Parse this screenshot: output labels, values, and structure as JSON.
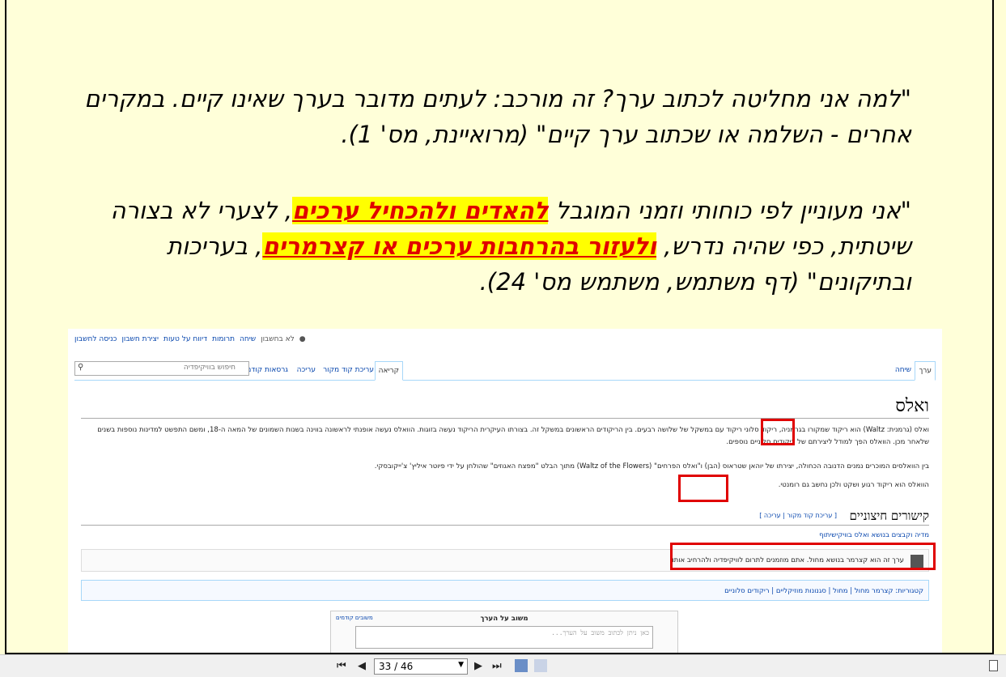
{
  "slide": {
    "quote1": "\"למה אני מחליטה לכתוב ערך? זה מורכב: לעתים מדובר בערך שאינו קיים. במקרים אחרים - השלמה או שכתוב ערך קיים\" (מרואיינת, מס' 1).",
    "quote2_part1": "\"אני מעוניין לפי כוחותי וזמני המוגבל ",
    "quote2_hl1": "להאדים ולהכחיל ערכים",
    "quote2_part2": ", לצערי לא בצורה שיטתית, כפי שהיה נדרש, ",
    "quote2_hl2": "ולעזור בהרחבות ערכים או קצרמרים",
    "quote2_part3": ", בעריכות ובתיקונים\" (דף משתמש, משתמש מס' 24)."
  },
  "wiki": {
    "personal": [
      "לא בחשבון",
      "שיחה",
      "תרומות",
      "דיווח על טעות",
      "יצירת חשבון",
      "כניסה לחשבון"
    ],
    "tabs_right": [
      "ערך",
      "שיחה"
    ],
    "tabs_left": [
      "קריאה",
      "עריכת קוד מקור",
      "עריכה",
      "גרסאות קודמות"
    ],
    "search_placeholder": "חיפוש בוויקיפדיה",
    "title": "ואלס",
    "para1": "ואלס (גרמנית: Waltz) הוא ריקוד שמקורו בגרמניה, ריקוד סלוני ריקוד עם במשקל של שלושה רבעים. בין הריקודים הראשונים במשקל זה. בצורתו העיקרית הריקוד נעשה בזוגות. הוואלס נעשה אופנתי לראשונה בווינה בשנות השמונים של המאה ה-18, ומשם התפשט למדינות נוספות בשנים שלאחר מכן. הוואלס הפך למודל ליצירתם של ריקודים סלוניים נוספים.",
    "para2": "בין הוואלסים המוכרים נמנים הדנובה הכחולה, יצירתו של יוהאן שטראוס (הבן) ו\"ואלס הפרחים\" (Waltz of the Flowers) מתוך הבלט \"מפצח האגוזים\" שהולחן על ידי פיוטר איליץ' צ'ייקובסקי.",
    "para3": "הוואלס הוא ריקוד רגוע ושקט ולכן נחשב גם רומנטי.",
    "section": "קישורים חיצוניים",
    "section_edit": "[ עריכת קוד מקור | עריכה ]",
    "commons": "מדיה וקבצים בנושא ואלס בוויקישיתוף",
    "stub": "ערך זה הוא קצרמר בנושא מחול. אתם מוזמנים לתרום לוויקיפדיה ולהרחיב אותו.",
    "categories": "קטגוריות:  קצרמר מחול | מחול | סגנונות מוזיקליים | ריקודים סלוניים",
    "feedback_title": "משוב על הערך",
    "feedback_prev": "משובים קודמים",
    "feedback_placeholder": "כאן ניתן לכתוב משוב על הערך..."
  },
  "toolbar": {
    "page_indicator": "33 / 46"
  }
}
